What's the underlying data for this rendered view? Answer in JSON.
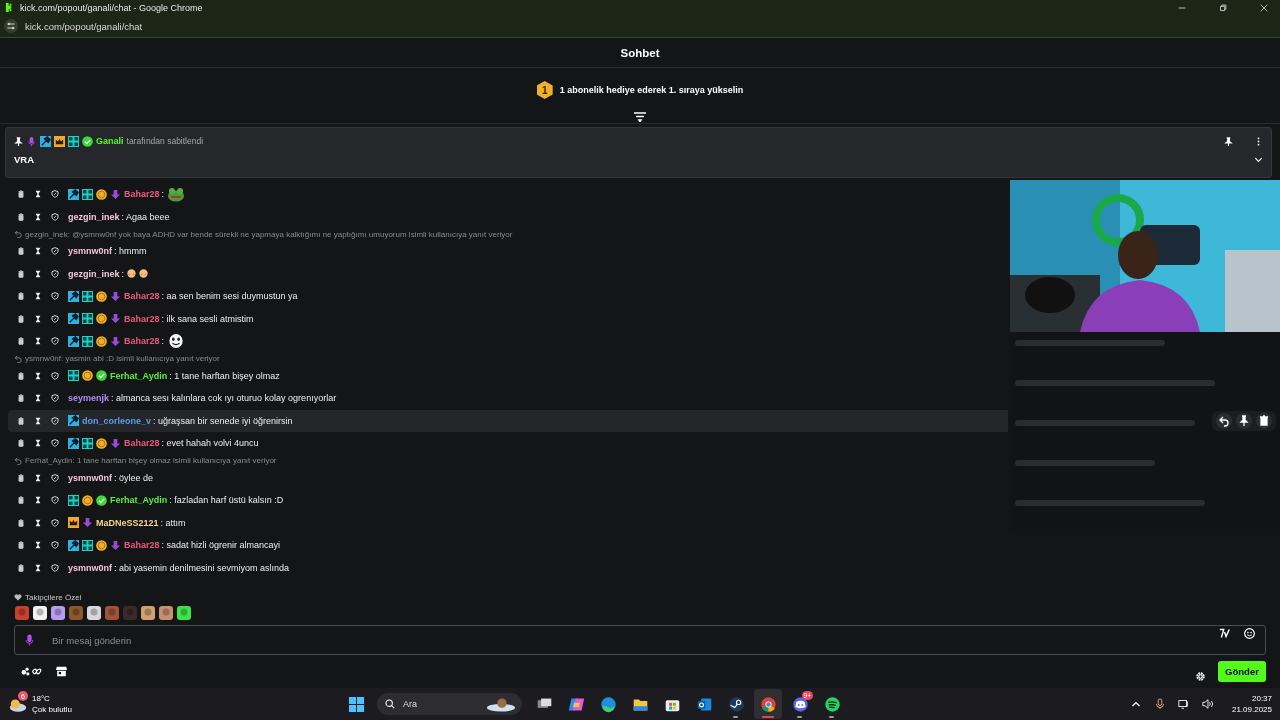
{
  "browser": {
    "title": "kick.com/popout/ganali/chat - Google Chrome",
    "url": "kick.com/popout/ganali/chat"
  },
  "chat": {
    "title": "Sohbet",
    "leaderboard": {
      "rank": "1",
      "text": "1 abonelik hediye ederek 1. sıraya yükselin"
    },
    "pinned": {
      "badges": [
        {
          "kind": "mic"
        },
        {
          "kind": "mod"
        },
        {
          "kind": "crown"
        },
        {
          "kind": "og"
        },
        {
          "kind": "verified"
        }
      ],
      "pinned_by": "Ganali",
      "color": "#53fc18",
      "note": "tarafından sabitlendi",
      "message": "VRA"
    },
    "messages": [
      {
        "kind": "message",
        "highlighted": false,
        "user": "Bahar28",
        "color": "#ea5a7e",
        "badges": [
          {
            "kind": "mod"
          },
          {
            "kind": "og"
          },
          {
            "kind": "sub"
          },
          {
            "kind": "gift"
          }
        ],
        "text": ":",
        "emotes": [
          {
            "kind": "frog"
          }
        ]
      },
      {
        "kind": "message",
        "highlighted": false,
        "user": "gezgin_inek",
        "color": "#f2cbd6",
        "text": ": Agaa beee"
      },
      {
        "kind": "reply",
        "text": "gezgin_inek: @ysmnw0nf yok baya ADHD var bende sürekli ne yapmaya kalktığımı ne yaptığımı umuyorum isimli kullanıcıya yanıt veriyor"
      },
      {
        "kind": "message",
        "highlighted": false,
        "user": "ysmnw0nf",
        "color": "#f4c4d4",
        "text": ": hmmm"
      },
      {
        "kind": "message",
        "highlighted": false,
        "user": "gezgin_inek",
        "color": "#f2cbd6",
        "text": ":",
        "emotes": [
          {
            "kind": "blush"
          },
          {
            "kind": "blush"
          }
        ]
      },
      {
        "kind": "message",
        "highlighted": false,
        "user": "Bahar28",
        "color": "#ea5a7e",
        "badges": [
          {
            "kind": "mod"
          },
          {
            "kind": "og"
          },
          {
            "kind": "sub"
          },
          {
            "kind": "gift"
          }
        ],
        "text": ": aa sen benim sesi duymustun ya"
      },
      {
        "kind": "message",
        "highlighted": false,
        "user": "Bahar28",
        "color": "#ea5a7e",
        "badges": [
          {
            "kind": "mod"
          },
          {
            "kind": "og"
          },
          {
            "kind": "sub"
          },
          {
            "kind": "gift"
          }
        ],
        "text": ": ilk sana sesli atmistim"
      },
      {
        "kind": "message",
        "highlighted": false,
        "user": "Bahar28",
        "color": "#ea5a7e",
        "badges": [
          {
            "kind": "mod"
          },
          {
            "kind": "og"
          },
          {
            "kind": "sub"
          },
          {
            "kind": "gift"
          }
        ],
        "text": ":",
        "emotes": [
          {
            "kind": "face"
          }
        ]
      },
      {
        "kind": "reply",
        "text": "ysmnw0nf: yasmin abi :D isimli kullanıcıya yanıt veriyor"
      },
      {
        "kind": "message",
        "highlighted": false,
        "user": "Ferhat_Aydin",
        "color": "#58f03a",
        "badges": [
          {
            "kind": "og"
          },
          {
            "kind": "sub"
          },
          {
            "kind": "verified"
          }
        ],
        "text": ": 1 tane harftan bişey olmaz"
      },
      {
        "kind": "message",
        "highlighted": false,
        "user": "seymenjk",
        "color": "#b08cf5",
        "text": ": almanca sesı kalınlara cok ıyı oturuo kolay ogrenıyorlar"
      },
      {
        "kind": "message",
        "highlighted": true,
        "user": "don_corleone_v",
        "color": "#5e9bea",
        "badges": [
          {
            "kind": "mod"
          }
        ],
        "text": ": uğraşsan bir senede iyi öğrenirsin"
      },
      {
        "kind": "message",
        "highlighted": false,
        "user": "Bahar28",
        "color": "#ea5a7e",
        "badges": [
          {
            "kind": "mod"
          },
          {
            "kind": "og"
          },
          {
            "kind": "sub"
          },
          {
            "kind": "gift"
          }
        ],
        "text": ": evet hahah volvi 4uncu"
      },
      {
        "kind": "reply",
        "text": "Ferhat_Aydin: 1 tane harftan bişey olmaz isimli kullanıcıya yanıt veriyor"
      },
      {
        "kind": "message",
        "highlighted": false,
        "user": "ysmnw0nf",
        "color": "#f4c4d4",
        "text": ": öylee de"
      },
      {
        "kind": "message",
        "highlighted": false,
        "user": "Ferhat_Aydin",
        "color": "#58f03a",
        "badges": [
          {
            "kind": "og"
          },
          {
            "kind": "sub"
          },
          {
            "kind": "verified"
          }
        ],
        "text": ": fazladan harf üstü kalsın :D"
      },
      {
        "kind": "message",
        "highlighted": false,
        "user": "MaDNeSS2121",
        "color": "#f5d491",
        "badges": [
          {
            "kind": "crown"
          },
          {
            "kind": "gift"
          }
        ],
        "text": ": attım"
      },
      {
        "kind": "message",
        "highlighted": false,
        "user": "Bahar28",
        "color": "#ea5a7e",
        "badges": [
          {
            "kind": "mod"
          },
          {
            "kind": "og"
          },
          {
            "kind": "sub"
          },
          {
            "kind": "gift"
          }
        ],
        "text": ": sadat hizli ögrenir almancayi"
      },
      {
        "kind": "message",
        "highlighted": false,
        "user": "ysmnw0nf",
        "color": "#f4c4d4",
        "text": ": abi yasemin denilmesini sevmiyom aslında"
      }
    ],
    "followers_only": {
      "label": "Takipçilere Özel"
    },
    "input": {
      "placeholder": "Bir mesaj gönderin"
    },
    "send_button": "Gönder"
  },
  "taskbar": {
    "weather": {
      "badge": "6",
      "temperature": "18°C",
      "condition": "Çok bulutlu"
    },
    "search": {
      "placeholder": "Ara"
    },
    "apps": [
      {
        "kind": "taskview",
        "active": false,
        "running": false
      },
      {
        "kind": "copilot",
        "active": false,
        "running": false
      },
      {
        "kind": "edge",
        "active": false,
        "running": false
      },
      {
        "kind": "explorer",
        "active": false,
        "running": false
      },
      {
        "kind": "store",
        "active": false,
        "running": false
      },
      {
        "kind": "outlook",
        "active": false,
        "running": false
      },
      {
        "kind": "steam",
        "active": false,
        "running": true
      },
      {
        "kind": "chrome",
        "active": true,
        "running": true
      },
      {
        "kind": "discord",
        "active": false,
        "running": true,
        "badge": "9+"
      },
      {
        "kind": "spotify",
        "active": false,
        "running": true
      }
    ],
    "time": "20:37",
    "date": "21.09.2025"
  }
}
